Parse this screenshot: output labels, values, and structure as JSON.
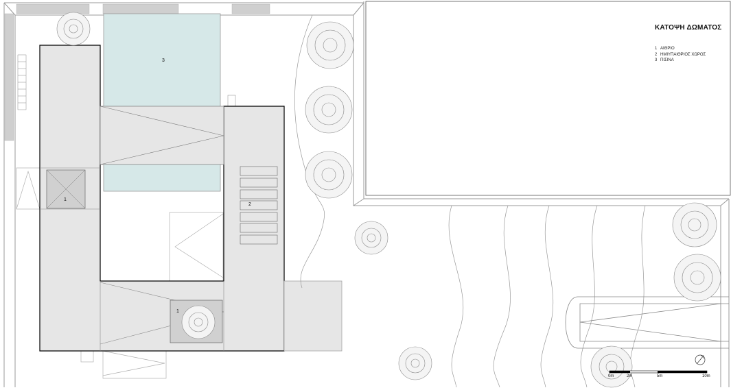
{
  "plan": {
    "title": "ΚΑΤΟΨΗ ΔΩΜΑΤΟΣ",
    "legend": [
      {
        "num": "1",
        "label": "ΑΙΘΡΙΟ"
      },
      {
        "num": "2",
        "label": "ΗΜΙΥΠΑΙΘΡΙΟΣ ΧΩΡΟΣ"
      },
      {
        "num": "3",
        "label": "ΠΙΣΙΝΑ"
      }
    ],
    "labels": {
      "courtyard_a": "1",
      "courtyard_b": "1",
      "semi_outdoor": "2",
      "pool": "3"
    },
    "scale_bar": {
      "t0": "0m",
      "t1": "2m",
      "t2": "5m",
      "t3": "10m"
    }
  },
  "colors": {
    "roof": "#e6e6e6",
    "pool": "#d6e8e8",
    "line": "#000000",
    "thin": "#8a8a8a",
    "tree": "#9a9a9a"
  }
}
